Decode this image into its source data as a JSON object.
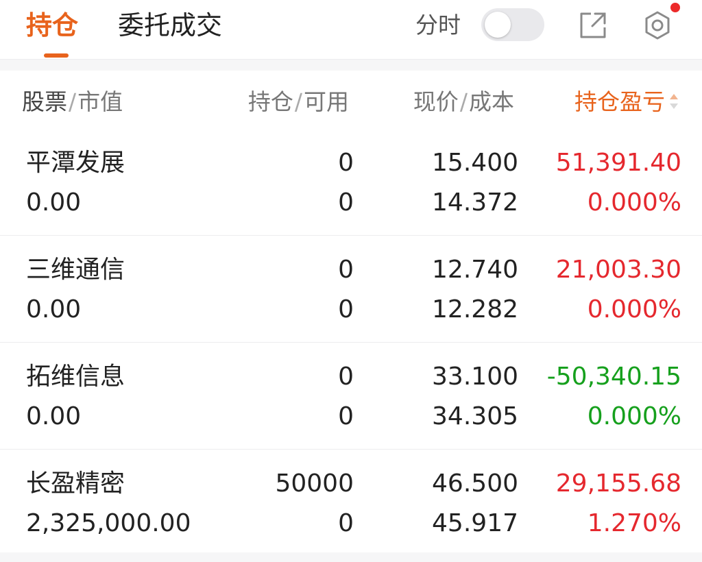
{
  "tabs": {
    "positions": "持仓",
    "orders": "委托成交"
  },
  "toolbar": {
    "intraday_label": "分时",
    "intraday_toggle_on": false,
    "share_icon": "share-external-icon",
    "settings_icon": "gear-icon",
    "settings_badge": true
  },
  "header": {
    "stock": "股票",
    "market_value": "市值",
    "position": "持仓",
    "available": "可用",
    "price": "现价",
    "cost": "成本",
    "pl": "持仓盈亏"
  },
  "rows": [
    {
      "name": "平潭发展",
      "market_value": "0.00",
      "position": "0",
      "available": "0",
      "price": "15.400",
      "cost": "14.372",
      "pl": "51,391.40",
      "pl_pct": "0.000%",
      "trend": "up"
    },
    {
      "name": "三维通信",
      "market_value": "0.00",
      "position": "0",
      "available": "0",
      "price": "12.740",
      "cost": "12.282",
      "pl": "21,003.30",
      "pl_pct": "0.000%",
      "trend": "up"
    },
    {
      "name": "拓维信息",
      "market_value": "0.00",
      "position": "0",
      "available": "0",
      "price": "33.100",
      "cost": "34.305",
      "pl": "-50,340.15",
      "pl_pct": "0.000%",
      "trend": "down"
    },
    {
      "name": "长盈精密",
      "market_value": "2,325,000.00",
      "position": "50000",
      "available": "0",
      "price": "46.500",
      "cost": "45.917",
      "pl": "29,155.68",
      "pl_pct": "1.270%",
      "trend": "up"
    }
  ],
  "colors": {
    "accent": "#e8631c",
    "up": "#e5282e",
    "down": "#16a01d"
  }
}
